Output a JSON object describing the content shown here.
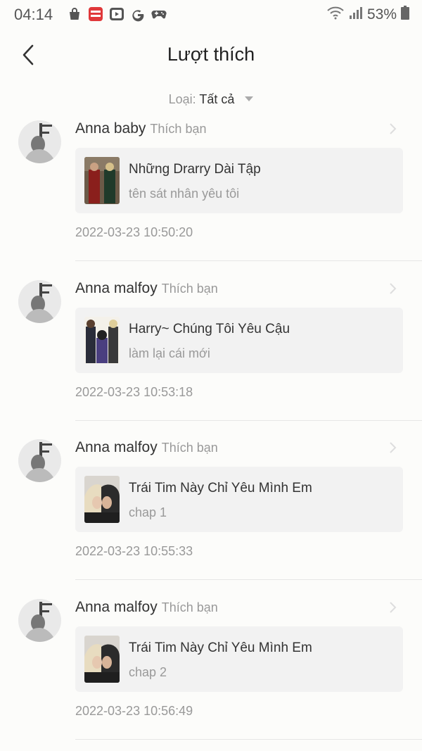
{
  "status_bar": {
    "time": "04:14",
    "battery": "53%",
    "left_icons": [
      "shopping-bag-icon",
      "manga-toon-app-icon",
      "youtube-app-icon",
      "google-icon",
      "gamepad-icon"
    ]
  },
  "header": {
    "title": "Lượt thích"
  },
  "filter": {
    "label": "Loại:",
    "value": "Tất cả"
  },
  "items": [
    {
      "user": "Anna baby",
      "action": "Thích bạn",
      "work_title": "Những Drarry Dài Tập",
      "work_subtitle": "tên sát nhân yêu tôi",
      "timestamp": "2022-03-23 10:50:20"
    },
    {
      "user": "Anna malfoy",
      "action": "Thích bạn",
      "work_title": "Harry~ Chúng Tôi Yêu Cậu",
      "work_subtitle": "làm lại cái mới",
      "timestamp": "2022-03-23 10:53:18"
    },
    {
      "user": "Anna malfoy",
      "action": "Thích bạn",
      "work_title": "Trái Tim Này Chỉ Yêu Mình Em",
      "work_subtitle": "chap 1",
      "timestamp": "2022-03-23 10:55:33"
    },
    {
      "user": "Anna malfoy",
      "action": "Thích bạn",
      "work_title": "Trái Tim Này Chỉ Yêu Mình Em",
      "work_subtitle": "chap 2",
      "timestamp": "2022-03-23 10:56:49"
    }
  ],
  "colors": {
    "background": "#fcfcfa",
    "card": "#f2f2f2",
    "muted_text": "#999999",
    "primary_text": "#333333"
  }
}
